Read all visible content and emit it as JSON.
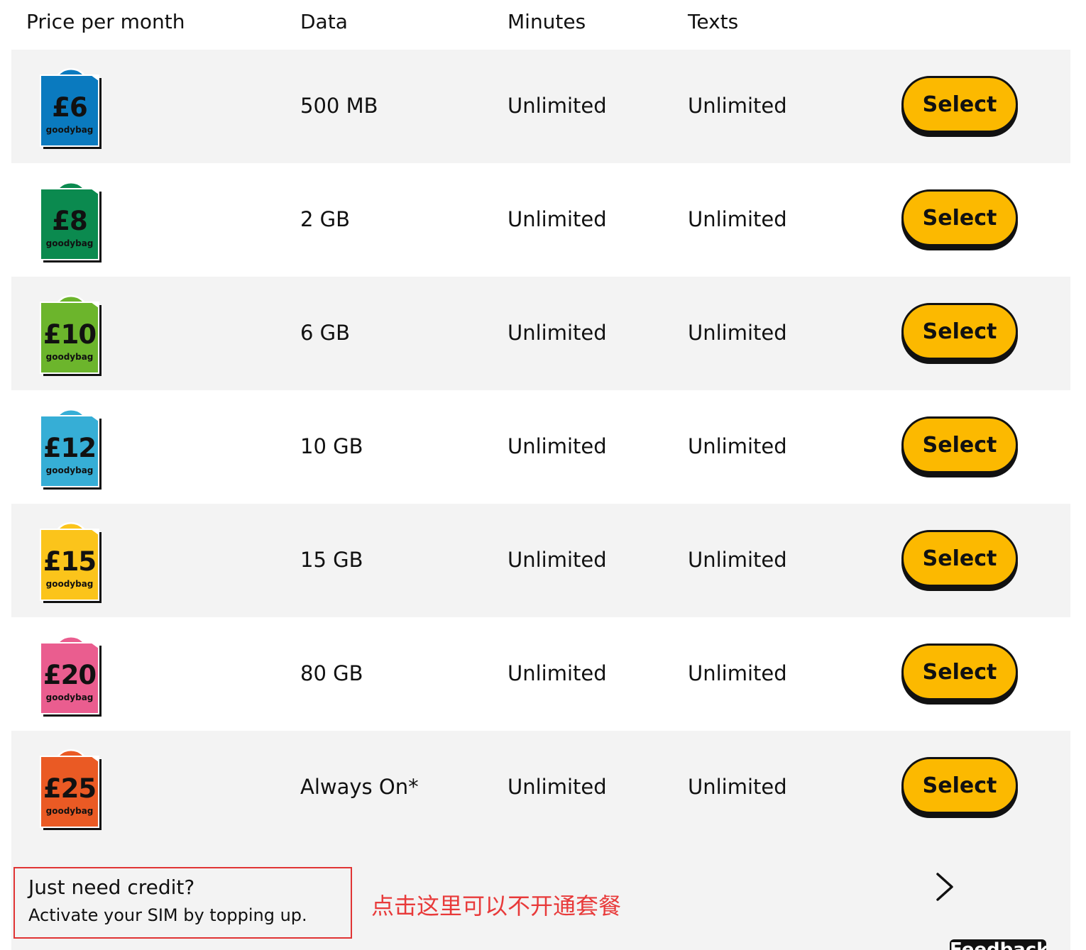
{
  "table": {
    "headers": {
      "price": "Price per month",
      "data": "Data",
      "minutes": "Minutes",
      "texts": "Texts"
    },
    "rows": [
      {
        "price": "£6",
        "brand": "goodybag",
        "bag_color": "#0a7abf",
        "data": "500 MB",
        "minutes": "Unlimited",
        "texts": "Unlimited",
        "button": "Select"
      },
      {
        "price": "£8",
        "brand": "goodybag",
        "bag_color": "#0b8a4f",
        "data": "2 GB",
        "minutes": "Unlimited",
        "texts": "Unlimited",
        "button": "Select"
      },
      {
        "price": "£10",
        "brand": "goodybag",
        "bag_color": "#6cb52c",
        "data": "6 GB",
        "minutes": "Unlimited",
        "texts": "Unlimited",
        "button": "Select"
      },
      {
        "price": "£12",
        "brand": "goodybag",
        "bag_color": "#36aed6",
        "data": "10 GB",
        "minutes": "Unlimited",
        "texts": "Unlimited",
        "button": "Select"
      },
      {
        "price": "£15",
        "brand": "goodybag",
        "bag_color": "#fbc41b",
        "data": "15 GB",
        "minutes": "Unlimited",
        "texts": "Unlimited",
        "button": "Select"
      },
      {
        "price": "£20",
        "brand": "goodybag",
        "bag_color": "#ea5d8f",
        "data": "80 GB",
        "minutes": "Unlimited",
        "texts": "Unlimited",
        "button": "Select"
      },
      {
        "price": "£25",
        "brand": "goodybag",
        "bag_color": "#ea5a24",
        "data": "Always On*",
        "minutes": "Unlimited",
        "texts": "Unlimited",
        "button": "Select"
      }
    ]
  },
  "credit": {
    "title": "Just need credit?",
    "subtitle": "Activate your SIM by topping up.",
    "annotation": "点击这里可以不开通套餐",
    "chevron_icon": "chevron-right-icon"
  },
  "feedback": {
    "label": "Feedback"
  },
  "colors": {
    "button_yellow": "#fcb900",
    "annotation_red": "#e83a3a",
    "row_shade": "#f3f3f3"
  }
}
